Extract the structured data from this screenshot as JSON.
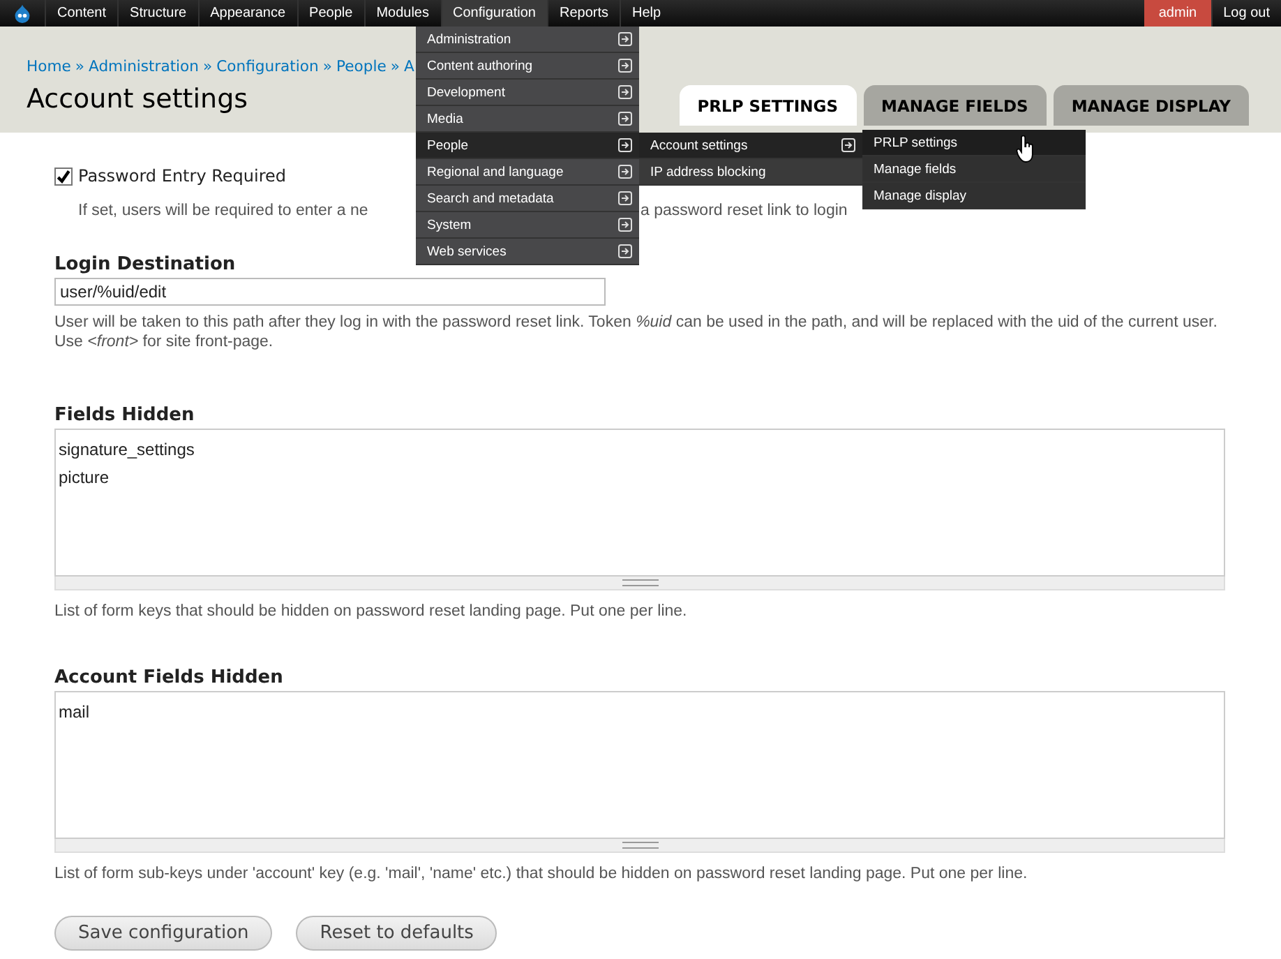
{
  "toolbar": {
    "items": [
      {
        "label": "Content",
        "selected": false
      },
      {
        "label": "Structure",
        "selected": false
      },
      {
        "label": "Appearance",
        "selected": false
      },
      {
        "label": "People",
        "selected": false
      },
      {
        "label": "Modules",
        "selected": false
      },
      {
        "label": "Configuration",
        "selected": true
      },
      {
        "label": "Reports",
        "selected": false
      },
      {
        "label": "Help",
        "selected": false
      }
    ],
    "user": "admin",
    "logout": "Log out"
  },
  "breadcrumb": {
    "links": [
      "Home",
      "Administration",
      "Configuration",
      "People",
      "A"
    ],
    "separators": [
      "»",
      "»",
      "»",
      "»"
    ]
  },
  "title": "Account settings",
  "tabs": [
    {
      "label": "PRLP SETTINGS",
      "selected": true
    },
    {
      "label": "MANAGE FIELDS",
      "selected": false
    },
    {
      "label": "MANAGE DISPLAY",
      "selected": false
    }
  ],
  "form": [
    {
      "kind": "checkbox",
      "label": "Password Entry Required",
      "checked": true,
      "description_parts": [
        "If set, users will be required to enter a ne",
        "a password reset link to login"
      ]
    },
    {
      "kind": "text",
      "label": "Login Destination",
      "value": "user/%uid/edit",
      "description": "User will be taken to this path after they log in with the password reset link. Token *%uid* can be used in the path, and will be replaced with the uid of the current user. Use *<front>* for site front-page."
    },
    {
      "kind": "textarea",
      "label": "Fields Hidden",
      "lines": [
        "signature_settings",
        "picture"
      ],
      "description": "List of form keys that should be hidden on password reset landing page. Put one per line."
    },
    {
      "kind": "textarea",
      "label": "Account Fields Hidden",
      "lines": [
        "mail"
      ],
      "description": "List of form sub-keys under 'account' key (e.g. 'mail', 'name' etc.) that should be hidden on password reset landing page. Put one per line."
    }
  ],
  "buttons": [
    "Save configuration",
    "Reset to defaults"
  ],
  "menus": [
    {
      "items": [
        {
          "label": "Administration",
          "selected": false
        },
        {
          "label": "Content authoring",
          "selected": false
        },
        {
          "label": "Development",
          "selected": false
        },
        {
          "label": "Media",
          "selected": false
        },
        {
          "label": "People",
          "selected": true
        },
        {
          "label": "Regional and language",
          "selected": false
        },
        {
          "label": "Search and metadata",
          "selected": false
        },
        {
          "label": "System",
          "selected": false
        },
        {
          "label": "Web services",
          "selected": false
        }
      ]
    },
    {
      "items": [
        {
          "label": "Account settings",
          "selected": true
        },
        {
          "label": "IP address blocking",
          "selected": false
        }
      ]
    },
    {
      "items": [
        {
          "label": "PRLP settings",
          "selected": true
        },
        {
          "label": "Manage fields",
          "selected": false
        },
        {
          "label": "Manage display",
          "selected": false
        }
      ]
    }
  ]
}
